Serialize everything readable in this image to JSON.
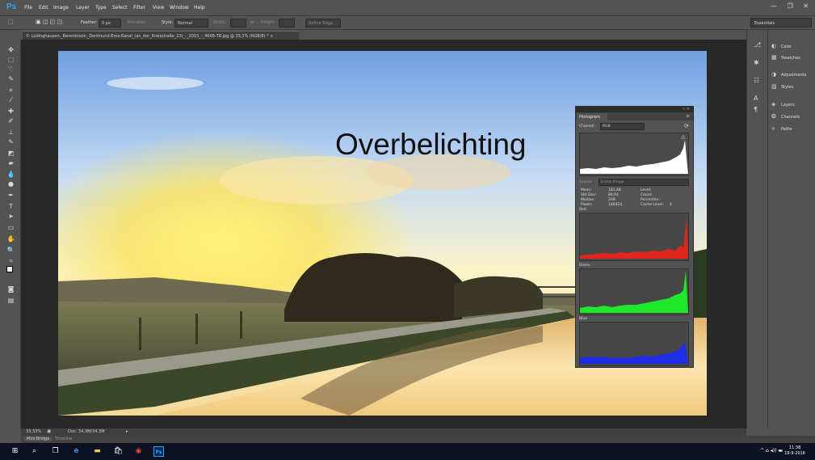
{
  "app": {
    "logo": "Ps"
  },
  "menu": [
    "File",
    "Edit",
    "Image",
    "Layer",
    "Type",
    "Select",
    "Filter",
    "View",
    "Window",
    "Help"
  ],
  "window_controls": {
    "minimize": "—",
    "restore": "❐",
    "close": "✕"
  },
  "options_bar": {
    "feather_label": "Feather:",
    "feather_value": "0 px",
    "antialias_label": "Anti-alias",
    "style_label": "Style:",
    "style_value": "Normal",
    "width_label": "Width:",
    "height_label": "Height:",
    "refine_edge": "Refine Edge..."
  },
  "workspace": "Essentials",
  "document_tab": "© Lüdinghausen,_Berenbrock,_Dortmund-Ems-Kanal_(an_der_Kreisstraße_23)_-_2015_-_4668-78.jpg @ 33,3% (RGB/8) * ×",
  "overlay_text": "Overbelichting",
  "histogram": {
    "tab": "Histogram",
    "channel_label": "Channel:",
    "channel_value": "RGB",
    "source_label": "Source:",
    "source_value": "Entire Image",
    "stats": [
      {
        "label": "Mean:",
        "value": "181,48"
      },
      {
        "label": "Std Dev:",
        "value": "80,04"
      },
      {
        "label": "Median:",
        "value": "208"
      },
      {
        "label": "Pixels:",
        "value": "186424"
      }
    ],
    "stats_right": [
      {
        "label": "Level:",
        "value": ""
      },
      {
        "label": "Count:",
        "value": ""
      },
      {
        "label": "Percentile:",
        "value": ""
      },
      {
        "label": "Cache Level:",
        "value": "4"
      }
    ],
    "channels": [
      {
        "name": "Red",
        "color": "#e0261c"
      },
      {
        "name": "Green",
        "color": "#1ee82a"
      },
      {
        "name": "Blue",
        "color": "#1f2ee6"
      }
    ]
  },
  "panels": [
    {
      "icon": "color-icon",
      "label": "Color"
    },
    {
      "icon": "swatches-icon",
      "label": "Swatches"
    },
    {
      "icon": "adjustments-icon",
      "label": "Adjustments"
    },
    {
      "icon": "styles-icon",
      "label": "Styles"
    },
    {
      "icon": "layers-icon",
      "label": "Layers"
    },
    {
      "icon": "channels-icon",
      "label": "Channels"
    },
    {
      "icon": "paths-icon",
      "label": "Paths"
    }
  ],
  "status": {
    "zoom": "33,33%",
    "doc": "Doc: 34,3M/34,3M"
  },
  "bottom_tabs": [
    "Mini Bridge",
    "Timeline"
  ],
  "taskbar": {
    "time": "11:38",
    "date": "19-9-2016"
  }
}
